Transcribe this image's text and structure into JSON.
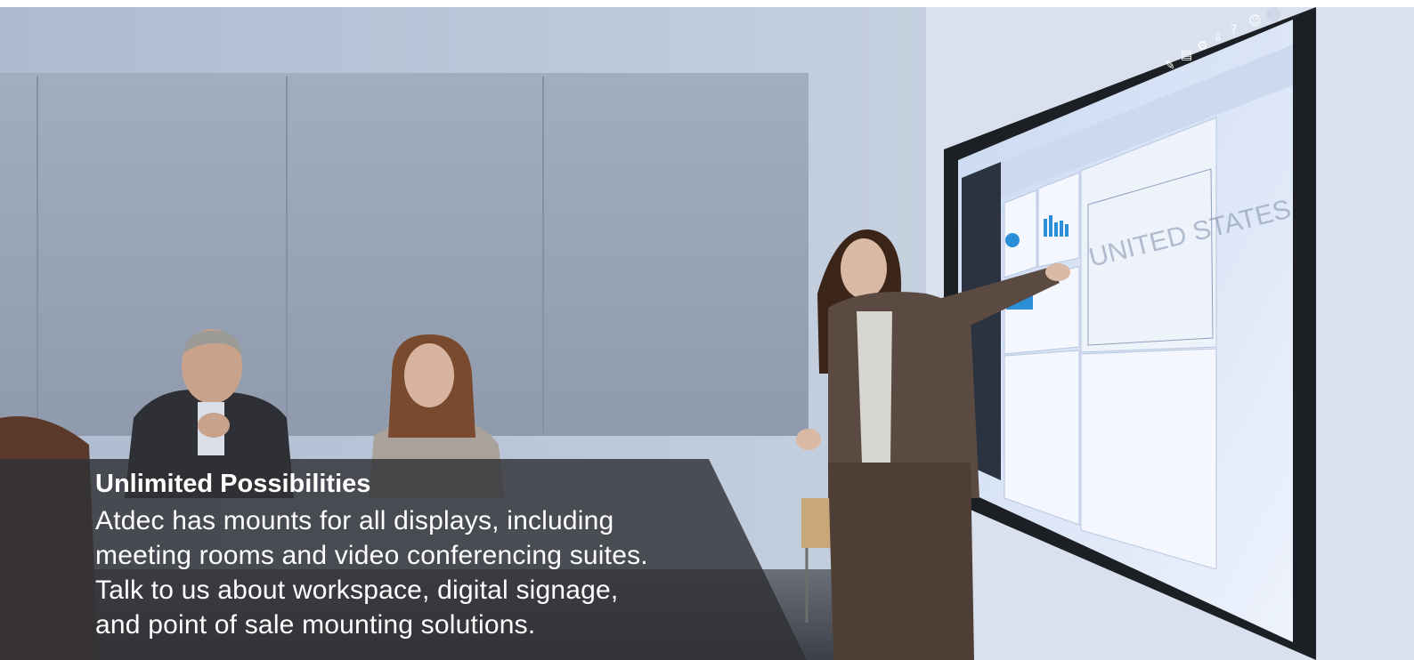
{
  "caption": {
    "title": "Unlimited Possibilities",
    "lines": [
      "Atdec has mounts for all displays, including",
      "meeting rooms and video conferencing suites.",
      "Talk to us about workspace, digital signage,",
      "and point of sale mounting solutions."
    ]
  },
  "screen_map": {
    "country_label": "UNITED STATES"
  },
  "colors": {
    "wall": "#b7c3d6",
    "panel": "#9aa6b6",
    "screen": "#dfe9fb",
    "screen_frame": "#1c1f24",
    "accent_blue": "#2a8fd6",
    "caption_bg": "#2f3135",
    "suit": "#5a4a42"
  },
  "icons": [
    "pen-icon",
    "bookmark-icon",
    "gear-icon",
    "download-icon",
    "help-icon",
    "smiley-icon",
    "avatar-icon"
  ]
}
